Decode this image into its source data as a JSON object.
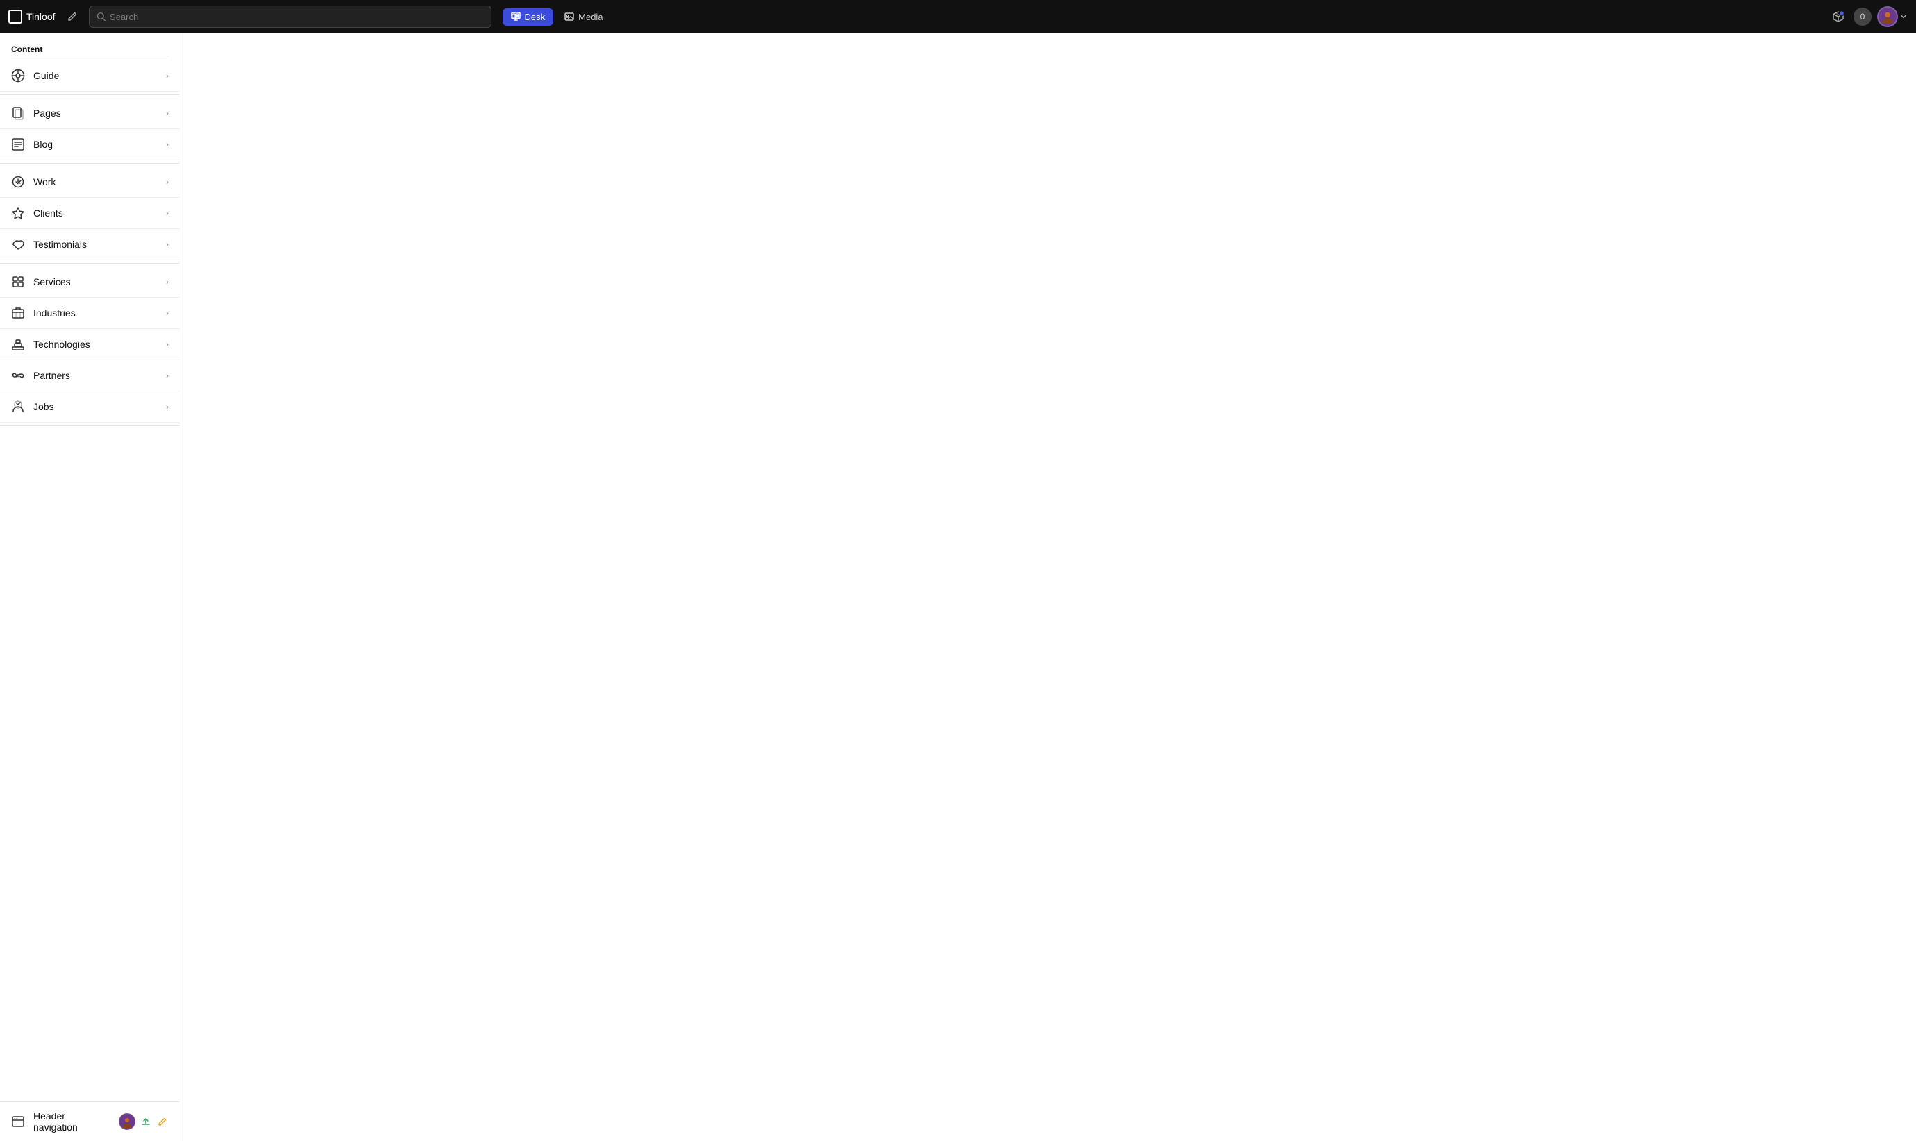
{
  "topnav": {
    "logo_label": "Tinloof",
    "search_placeholder": "Search",
    "tabs": [
      {
        "id": "desk",
        "label": "Desk",
        "active": true
      },
      {
        "id": "media",
        "label": "Media",
        "active": false
      }
    ],
    "notification_count": "0"
  },
  "sidebar": {
    "section_title": "Content",
    "items": [
      {
        "id": "guide",
        "label": "Guide",
        "icon": "guide-icon",
        "has_divider_after": true
      },
      {
        "id": "pages",
        "label": "Pages",
        "icon": "pages-icon",
        "has_divider_after": false
      },
      {
        "id": "blog",
        "label": "Blog",
        "icon": "blog-icon",
        "has_divider_after": true
      },
      {
        "id": "work",
        "label": "Work",
        "icon": "work-icon",
        "has_divider_after": false
      },
      {
        "id": "clients",
        "label": "Clients",
        "icon": "clients-icon",
        "has_divider_after": false
      },
      {
        "id": "testimonials",
        "label": "Testimonials",
        "icon": "testimonials-icon",
        "has_divider_after": true
      },
      {
        "id": "services",
        "label": "Services",
        "icon": "services-icon",
        "has_divider_after": false
      },
      {
        "id": "industries",
        "label": "Industries",
        "icon": "industries-icon",
        "has_divider_after": false
      },
      {
        "id": "technologies",
        "label": "Technologies",
        "icon": "technologies-icon",
        "has_divider_after": false
      },
      {
        "id": "partners",
        "label": "Partners",
        "icon": "partners-icon",
        "has_divider_after": false
      },
      {
        "id": "jobs",
        "label": "Jobs",
        "icon": "jobs-icon",
        "has_divider_after": true
      }
    ],
    "bottom_item": {
      "label": "Header navigation",
      "icon": "header-nav-icon"
    }
  }
}
